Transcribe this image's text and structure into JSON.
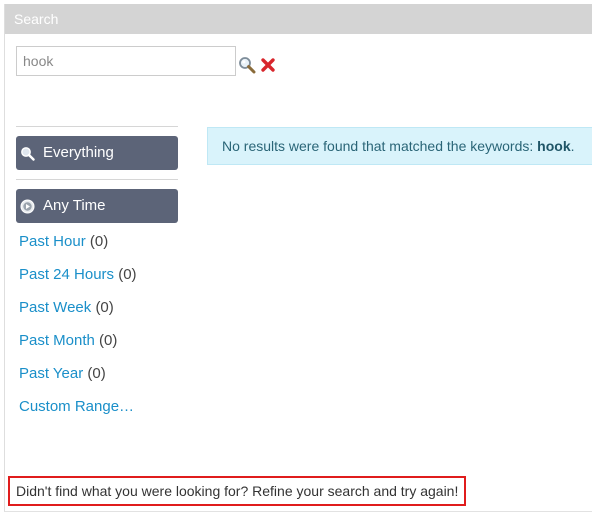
{
  "header": {
    "title": "Search"
  },
  "search": {
    "value": "hook",
    "search_icon": "magnifier-icon",
    "clear_icon": "red-x-icon"
  },
  "filters": {
    "content_type": {
      "label": "Everything",
      "icon": "magnifier-icon"
    },
    "time": {
      "label": "Any Time",
      "icon": "clock-icon"
    },
    "time_options": [
      {
        "label": "Past Hour",
        "count": "(0)"
      },
      {
        "label": "Past 24 Hours",
        "count": "(0)"
      },
      {
        "label": "Past Week",
        "count": "(0)"
      },
      {
        "label": "Past Month",
        "count": "(0)"
      },
      {
        "label": "Past Year",
        "count": "(0)"
      },
      {
        "label": "Custom Range…",
        "count": ""
      }
    ]
  },
  "results": {
    "message": "No results were found that matched the keywords:",
    "keyword": "hook",
    "period": "."
  },
  "footer": {
    "note": "Didn't find what you were looking for? Refine your search and try again!"
  },
  "colors": {
    "header_bg": "#d4d4d4",
    "filter_bg": "#5c6478",
    "link": "#1a8fc9",
    "alert_bg": "#d9f3fb",
    "highlight_border": "#e01c1c"
  }
}
